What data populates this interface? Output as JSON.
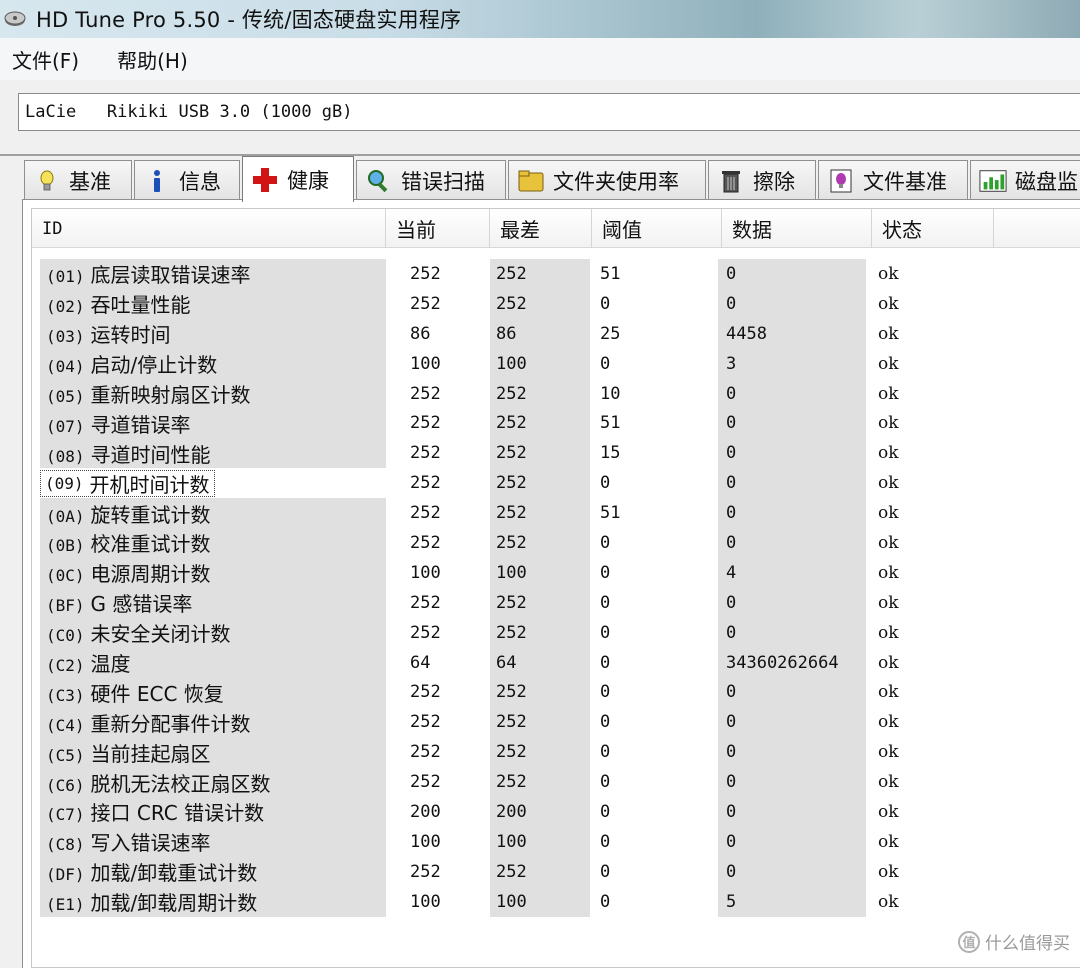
{
  "window": {
    "title": "HD Tune Pro 5.50 - 传统/固态硬盘实用程序"
  },
  "menu": [
    {
      "label": "文件(F)",
      "name": "menu-file"
    },
    {
      "label": "帮助(H)",
      "name": "menu-help"
    }
  ],
  "drive": {
    "selected": "LaCie   Rikiki USB 3.0 (1000 gB)"
  },
  "tabs": [
    {
      "label": "基准",
      "icon": "lightbulb-icon",
      "name": "tab-benchmark"
    },
    {
      "label": "信息",
      "icon": "info-icon",
      "name": "tab-info"
    },
    {
      "label": "健康",
      "icon": "health-cross-icon",
      "name": "tab-health",
      "active": true
    },
    {
      "label": "错误扫描",
      "icon": "magnifier-icon",
      "name": "tab-error-scan"
    },
    {
      "label": "文件夹使用率",
      "icon": "folder-icon",
      "name": "tab-folder-usage"
    },
    {
      "label": "擦除",
      "icon": "trash-icon",
      "name": "tab-erase"
    },
    {
      "label": "文件基准",
      "icon": "file-benchmark-icon",
      "name": "tab-file-benchmark"
    },
    {
      "label": "磁盘监",
      "icon": "disk-monitor-icon",
      "name": "tab-disk-monitor"
    }
  ],
  "table": {
    "columns": [
      "ID",
      "当前",
      "最差",
      "阈值",
      "数据",
      "状态"
    ],
    "selected_index": 7,
    "rows": [
      {
        "code": "(01)",
        "name": "底层读取错误速率",
        "current": "252",
        "worst": "252",
        "threshold": "51",
        "data": "0",
        "status": "ok"
      },
      {
        "code": "(02)",
        "name": "吞吐量性能",
        "current": "252",
        "worst": "252",
        "threshold": "0",
        "data": "0",
        "status": "ok"
      },
      {
        "code": "(03)",
        "name": "运转时间",
        "current": "86",
        "worst": "86",
        "threshold": "25",
        "data": "4458",
        "status": "ok"
      },
      {
        "code": "(04)",
        "name": "启动/停止计数",
        "current": "100",
        "worst": "100",
        "threshold": "0",
        "data": "3",
        "status": "ok"
      },
      {
        "code": "(05)",
        "name": "重新映射扇区计数",
        "current": "252",
        "worst": "252",
        "threshold": "10",
        "data": "0",
        "status": "ok"
      },
      {
        "code": "(07)",
        "name": "寻道错误率",
        "current": "252",
        "worst": "252",
        "threshold": "51",
        "data": "0",
        "status": "ok"
      },
      {
        "code": "(08)",
        "name": "寻道时间性能",
        "current": "252",
        "worst": "252",
        "threshold": "15",
        "data": "0",
        "status": "ok"
      },
      {
        "code": "(09)",
        "name": "开机时间计数",
        "current": "252",
        "worst": "252",
        "threshold": "0",
        "data": "0",
        "status": "ok"
      },
      {
        "code": "(0A)",
        "name": "旋转重试计数",
        "current": "252",
        "worst": "252",
        "threshold": "51",
        "data": "0",
        "status": "ok"
      },
      {
        "code": "(0B)",
        "name": "校准重试计数",
        "current": "252",
        "worst": "252",
        "threshold": "0",
        "data": "0",
        "status": "ok"
      },
      {
        "code": "(0C)",
        "name": "电源周期计数",
        "current": "100",
        "worst": "100",
        "threshold": "0",
        "data": "4",
        "status": "ok"
      },
      {
        "code": "(BF)",
        "name": "G 感错误率",
        "current": "252",
        "worst": "252",
        "threshold": "0",
        "data": "0",
        "status": "ok"
      },
      {
        "code": "(C0)",
        "name": "未安全关闭计数",
        "current": "252",
        "worst": "252",
        "threshold": "0",
        "data": "0",
        "status": "ok"
      },
      {
        "code": "(C2)",
        "name": "温度",
        "current": "64",
        "worst": "64",
        "threshold": "0",
        "data": "34360262664",
        "status": "ok"
      },
      {
        "code": "(C3)",
        "name": "硬件 ECC 恢复",
        "current": "252",
        "worst": "252",
        "threshold": "0",
        "data": "0",
        "status": "ok"
      },
      {
        "code": "(C4)",
        "name": "重新分配事件计数",
        "current": "252",
        "worst": "252",
        "threshold": "0",
        "data": "0",
        "status": "ok"
      },
      {
        "code": "(C5)",
        "name": "当前挂起扇区",
        "current": "252",
        "worst": "252",
        "threshold": "0",
        "data": "0",
        "status": "ok"
      },
      {
        "code": "(C6)",
        "name": "脱机无法校正扇区数",
        "current": "252",
        "worst": "252",
        "threshold": "0",
        "data": "0",
        "status": "ok"
      },
      {
        "code": "(C7)",
        "name": "接口 CRC 错误计数",
        "current": "200",
        "worst": "200",
        "threshold": "0",
        "data": "0",
        "status": "ok"
      },
      {
        "code": "(C8)",
        "name": "写入错误速率",
        "current": "100",
        "worst": "100",
        "threshold": "0",
        "data": "0",
        "status": "ok"
      },
      {
        "code": "(DF)",
        "name": "加载/卸载重试计数",
        "current": "252",
        "worst": "252",
        "threshold": "0",
        "data": "0",
        "status": "ok"
      },
      {
        "code": "(E1)",
        "name": "加载/卸载周期计数",
        "current": "100",
        "worst": "100",
        "threshold": "0",
        "data": "5",
        "status": "ok"
      }
    ]
  },
  "watermark": {
    "icon": "zhidemai-icon",
    "glyph": "值",
    "text": "什么值得买"
  }
}
